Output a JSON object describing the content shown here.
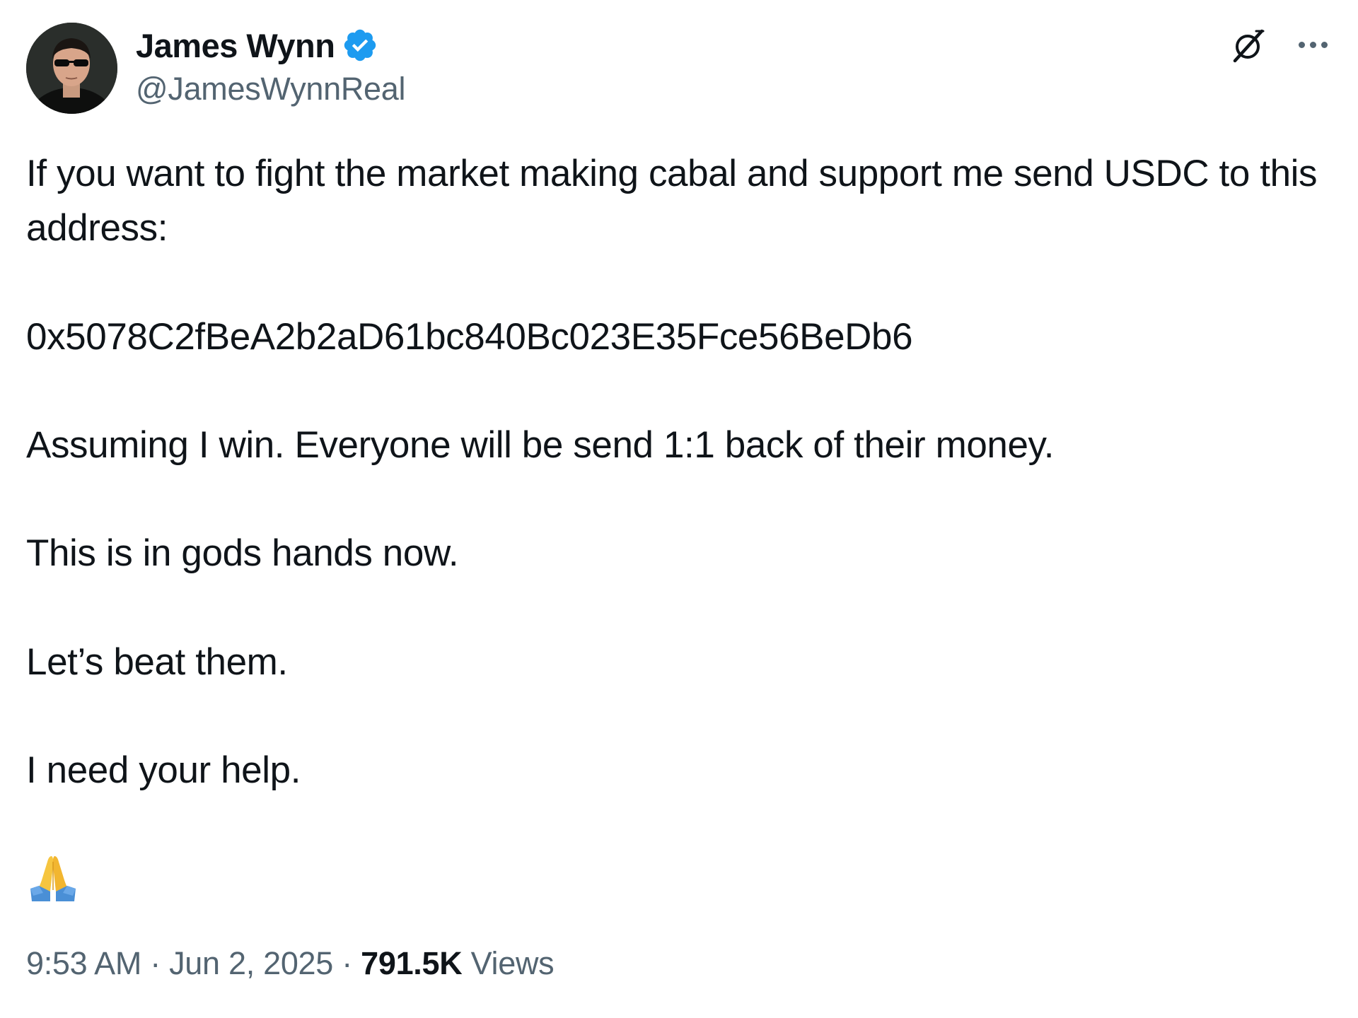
{
  "author": {
    "display_name": "James Wynn",
    "handle": "@JamesWynnReal",
    "verified_icon": "verified-badge-icon",
    "avatar_icon": "avatar"
  },
  "actions": {
    "grok_icon": "grok-icon",
    "more_icon": "more-icon"
  },
  "tweet": {
    "paragraphs": [
      "If you want to fight the market making cabal and support me send USDC to this address:",
      "0x5078C2fBeA2b2aD61bc840Bc023E35Fce56BeDb6",
      "Assuming I win. Everyone will be send 1:1 back of their money.",
      "This is in gods hands now.",
      "Let’s beat them.",
      "I need your help."
    ],
    "emoji": "🙏"
  },
  "meta": {
    "time": "9:53 AM",
    "separator": " · ",
    "date": "Jun 2, 2025",
    "views_count": "791.5K",
    "views_label": "Views"
  },
  "colors": {
    "text_primary": "#0f1419",
    "text_secondary": "#536471",
    "verified_blue": "#1d9bf0",
    "background": "#ffffff"
  }
}
